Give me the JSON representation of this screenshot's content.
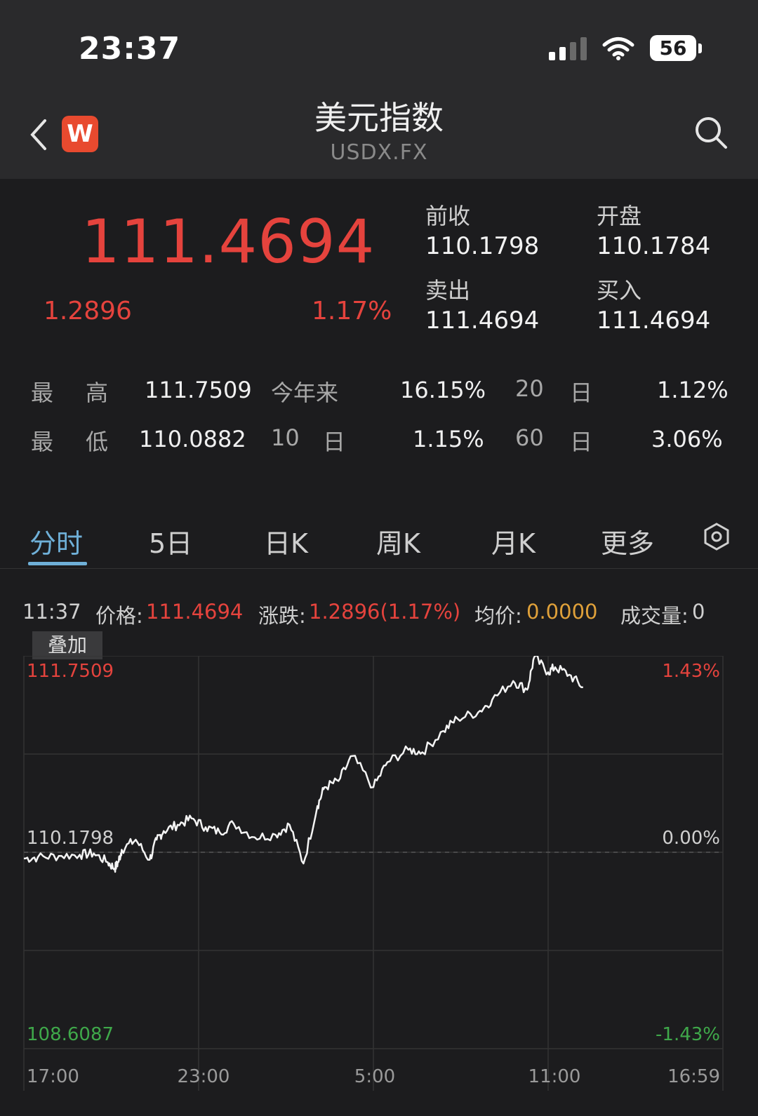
{
  "status": {
    "time": "23:37",
    "battery": "56"
  },
  "nav": {
    "title": "美元指数",
    "subtitle": "USDX.FX",
    "logo_letter": "W"
  },
  "quote": {
    "price": "111.4694",
    "change": "1.2896",
    "change_pct": "1.17%",
    "fields": [
      {
        "label": "前收",
        "value": "110.1798"
      },
      {
        "label": "开盘",
        "value": "110.1784"
      },
      {
        "label": "卖出",
        "value": "111.4694"
      },
      {
        "label": "买入",
        "value": "111.4694"
      }
    ]
  },
  "stats": [
    {
      "label": [
        "最",
        "高"
      ],
      "value": "111.7509"
    },
    {
      "label": [
        "今年来"
      ],
      "value": "16.15%"
    },
    {
      "label": [
        "20",
        "日"
      ],
      "value": "1.12%"
    },
    {
      "label": [
        "最",
        "低"
      ],
      "value": "110.0882"
    },
    {
      "label": [
        "10",
        "日"
      ],
      "value": "1.15%"
    },
    {
      "label": [
        "60",
        "日"
      ],
      "value": "3.06%"
    }
  ],
  "tabs": [
    "分时",
    "5日",
    "日K",
    "周K",
    "月K",
    "更多"
  ],
  "active_tab": "分时",
  "info": {
    "time": "11:37",
    "price_label": "价格:",
    "price": "111.4694",
    "change_label": "涨跌:",
    "change": "1.2896(1.17%)",
    "avg_label": "均价:",
    "avg": "0.0000",
    "volume_label": "成交量:",
    "volume": "0"
  },
  "overlay_label": "叠加",
  "colors": {
    "up": "#e5433d",
    "down": "#3fa84a",
    "accent": "#6fb0d8",
    "avg": "#e0a13a"
  },
  "chart_data": {
    "type": "line",
    "ylim": [
      108.6087,
      111.7509
    ],
    "y_ticks_left": [
      "111.7509",
      "110.1798",
      "108.6087"
    ],
    "y_ticks_right": [
      "1.43%",
      "0.00%",
      "-1.43%"
    ],
    "x_ticks": [
      "17:00",
      "23:00",
      "5:00",
      "11:00",
      "16:59"
    ],
    "baseline": 110.1798,
    "x": [
      0,
      0.02,
      0.05,
      0.08,
      0.1,
      0.12,
      0.13,
      0.135,
      0.14,
      0.16,
      0.18,
      0.19,
      0.2,
      0.22,
      0.24,
      0.26,
      0.28,
      0.3,
      0.33,
      0.36,
      0.38,
      0.4,
      0.42,
      0.43,
      0.45,
      0.47,
      0.5,
      0.52,
      0.55,
      0.57,
      0.6,
      0.62,
      0.65,
      0.67,
      0.7,
      0.72,
      0.73,
      0.75,
      0.76,
      0.78,
      0.8
    ],
    "y": [
      110.13,
      110.14,
      110.15,
      110.16,
      110.17,
      110.1,
      110.05,
      110.1,
      110.2,
      110.28,
      110.12,
      110.28,
      110.35,
      110.4,
      110.45,
      110.38,
      110.34,
      110.41,
      110.3,
      110.32,
      110.4,
      110.09,
      110.55,
      110.7,
      110.75,
      110.95,
      110.7,
      110.9,
      111.0,
      110.98,
      111.15,
      111.25,
      111.3,
      111.4,
      111.55,
      111.48,
      111.74,
      111.62,
      111.66,
      111.6,
      111.5
    ]
  }
}
